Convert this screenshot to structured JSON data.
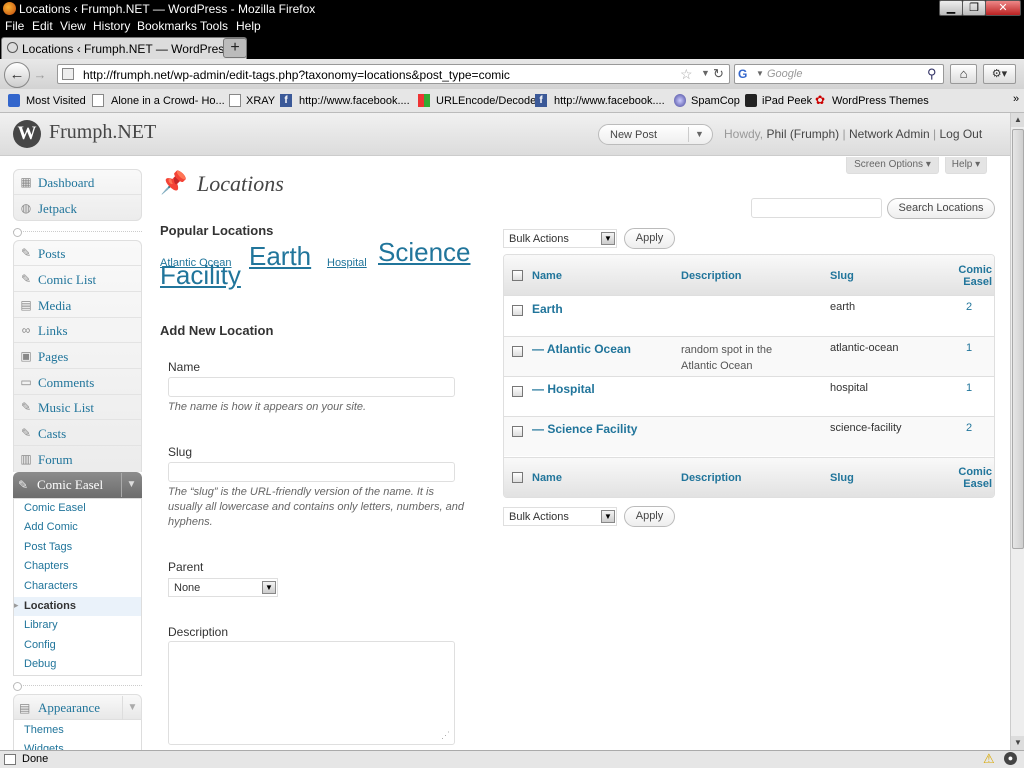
{
  "window": {
    "title": "Locations ‹ Frumph.NET — WordPress - Mozilla Firefox"
  },
  "menu": [
    "File",
    "Edit",
    "View",
    "History",
    "Bookmarks",
    "Tools",
    "Help"
  ],
  "tab": {
    "label": "Locations ‹ Frumph.NET — WordPress"
  },
  "url": "http://frumph.net/wp-admin/edit-tags.php?taxonomy=locations&post_type=comic",
  "search": {
    "placeholder": "Google"
  },
  "bookmarks": [
    "Most Visited",
    "Alone in a Crowd- Ho...",
    "XRAY",
    "http://www.facebook....",
    "URLEncode/Decode",
    "http://www.facebook....",
    "SpamCop",
    "iPad Peek",
    "WordPress Themes"
  ],
  "site": {
    "name": "Frumph.NET"
  },
  "header": {
    "new_post": "New Post",
    "howdy": "Howdy,",
    "user": "Phil (Frumph)",
    "sep": "|",
    "network_admin": "Network Admin",
    "log_out": "Log Out",
    "screen_options": "Screen Options",
    "help": "Help"
  },
  "sidebar": {
    "top": [
      "Dashboard",
      "Jetpack"
    ],
    "main": [
      "Posts",
      "Comic List",
      "Media",
      "Links",
      "Pages",
      "Comments",
      "Music List",
      "Casts",
      "Forum"
    ],
    "comic_easel": "Comic Easel",
    "sub": [
      "Comic Easel",
      "Add Comic",
      "Post Tags",
      "Chapters",
      "Characters",
      "Locations",
      "Library",
      "Config",
      "Debug"
    ],
    "appearance": "Appearance",
    "appearance_sub": [
      "Themes",
      "Widgets"
    ]
  },
  "page": {
    "title": "Locations",
    "search_button": "Search Locations"
  },
  "popular": {
    "heading": "Popular Locations",
    "tags": [
      "Atlantic Ocean",
      "Earth",
      "Hospital",
      "Science Facility"
    ]
  },
  "form": {
    "heading": "Add New Location",
    "name_label": "Name",
    "name_help": "The name is how it appears on your site.",
    "slug_label": "Slug",
    "slug_help": "The “slug” is the URL-friendly version of the name. It is usually all lowercase and contains only letters, numbers, and hyphens.",
    "parent_label": "Parent",
    "parent_value": "None",
    "desc_label": "Description"
  },
  "table": {
    "bulk_actions": "Bulk Actions",
    "apply": "Apply",
    "columns": [
      "Name",
      "Description",
      "Slug",
      "Comic Easel"
    ],
    "rows": [
      {
        "name": "Earth",
        "description": "",
        "slug": "earth",
        "count": "2"
      },
      {
        "name": "— Atlantic Ocean",
        "description": "random spot in the Atlantic Ocean",
        "slug": "atlantic-ocean",
        "count": "1"
      },
      {
        "name": "— Hospital",
        "description": "",
        "slug": "hospital",
        "count": "1"
      },
      {
        "name": "— Science Facility",
        "description": "",
        "slug": "science-facility",
        "count": "2"
      }
    ]
  },
  "status": {
    "text": "Done"
  },
  "colors": {
    "link": "#21759b",
    "header_bg": "#dcdcdc",
    "active_menu": "#6d6d6d"
  }
}
